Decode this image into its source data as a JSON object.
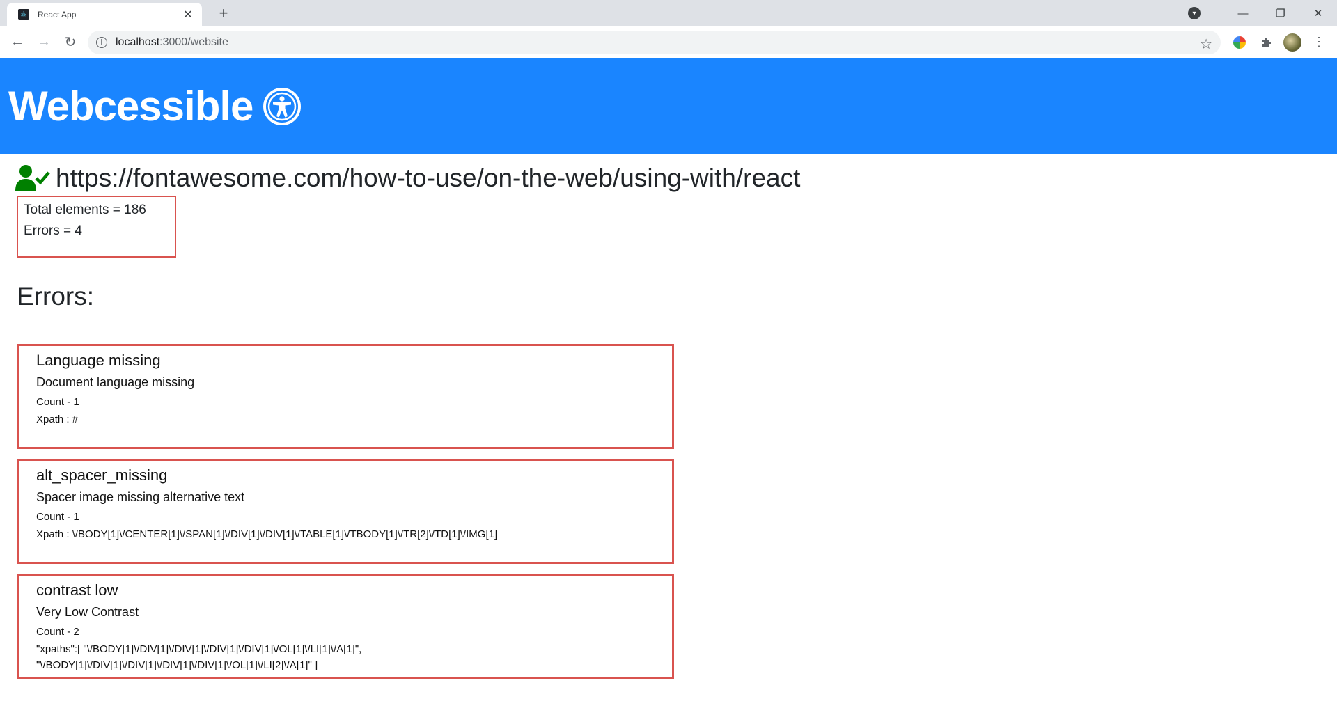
{
  "browser": {
    "tab_title": "React App",
    "tab_close": "✕",
    "new_tab": "+",
    "url_host": "localhost",
    "url_rest": ":3000/website"
  },
  "header": {
    "title": "Webcessible",
    "color": "#1a85ff"
  },
  "site": {
    "url": "https://fontawesome.com/how-to-use/on-the-web/using-with/react",
    "icon": "user-check-icon",
    "icon_color": "#008000"
  },
  "summary": {
    "total_label": "Total elements = 186",
    "errors_label": "Errors = 4"
  },
  "errors_heading": "Errors:",
  "errors": [
    {
      "title": "Language missing",
      "description": "Document language missing",
      "count": "Count - 1",
      "xpath": "Xpath : #"
    },
    {
      "title": "alt_spacer_missing",
      "description": "Spacer image missing alternative text",
      "count": "Count - 1",
      "xpath": "Xpath : \\/BODY[1]\\/CENTER[1]\\/SPAN[1]\\/DIV[1]\\/DIV[1]\\/TABLE[1]\\/TBODY[1]\\/TR[2]\\/TD[1]\\/IMG[1]"
    },
    {
      "title": "contrast low",
      "description": "Very Low Contrast",
      "count": "Count - 2",
      "xpath_line1": "\"xpaths\":[ \"\\/BODY[1]\\/DIV[1]\\/DIV[1]\\/DIV[1]\\/DIV[1]\\/OL[1]\\/LI[1]\\/A[1]\",",
      "xpath_line2": "\"\\/BODY[1]\\/DIV[1]\\/DIV[1]\\/DIV[1]\\/DIV[1]\\/OL[1]\\/LI[2]\\/A[1]\" ]"
    }
  ],
  "accent_color": "#d9534f"
}
